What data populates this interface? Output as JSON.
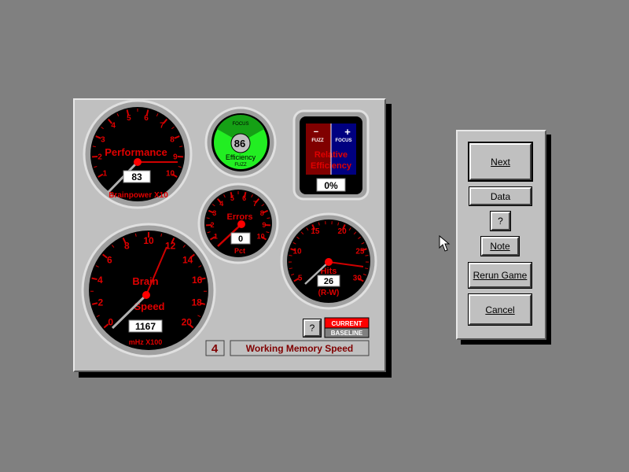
{
  "performance": {
    "title": "Performance",
    "value": "83",
    "sublabel": "Brainpower X10",
    "ticks": [
      "1",
      "2",
      "3",
      "4",
      "5",
      "6",
      "7",
      "8",
      "9",
      "10"
    ]
  },
  "efficiency": {
    "focus_label": "FOCUS",
    "fuzz_label": "FUZZ",
    "value": "86",
    "label": "Efficiency"
  },
  "relative_efficiency": {
    "minus": "−",
    "plus": "+",
    "fuzz_label": "FUZZ",
    "focus_label": "FOCUS",
    "title_line1": "Relative",
    "title_line2": "Efficiency",
    "value": "0%"
  },
  "errors": {
    "title": "Errors",
    "value": "0",
    "sublabel": "Pct",
    "ticks": [
      "1",
      "2",
      "3",
      "4",
      "5",
      "6",
      "7",
      "8",
      "9",
      "10"
    ]
  },
  "brain_speed": {
    "title_line1": "Brain",
    "title_line2": "Speed",
    "value": "1167",
    "sublabel": "mHz X100",
    "ticks": [
      "0",
      "2",
      "4",
      "6",
      "8",
      "10",
      "12",
      "14",
      "16",
      "18",
      "20"
    ]
  },
  "hits": {
    "title": "Hits",
    "value": "26",
    "sublabel": "(R-W)",
    "ticks": [
      "5",
      "10",
      "15",
      "20",
      "25",
      "30"
    ]
  },
  "bottom": {
    "help_label": "?",
    "current_label": "CURRENT",
    "baseline_label": "BASELINE",
    "level": "4",
    "mode_label": "Working Memory Speed"
  },
  "buttons": {
    "next": "Next",
    "data": "Data",
    "help": "?",
    "note": "Note",
    "rerun": "Rerun Game",
    "cancel": "Cancel"
  },
  "colors": {
    "gauge_red": "#ff0000",
    "dial_black": "#000000",
    "panel_gray": "#c0c0c0",
    "efficiency_green": "#22ee22",
    "focus_blue": "#000080",
    "fuzz_red": "#800000"
  }
}
